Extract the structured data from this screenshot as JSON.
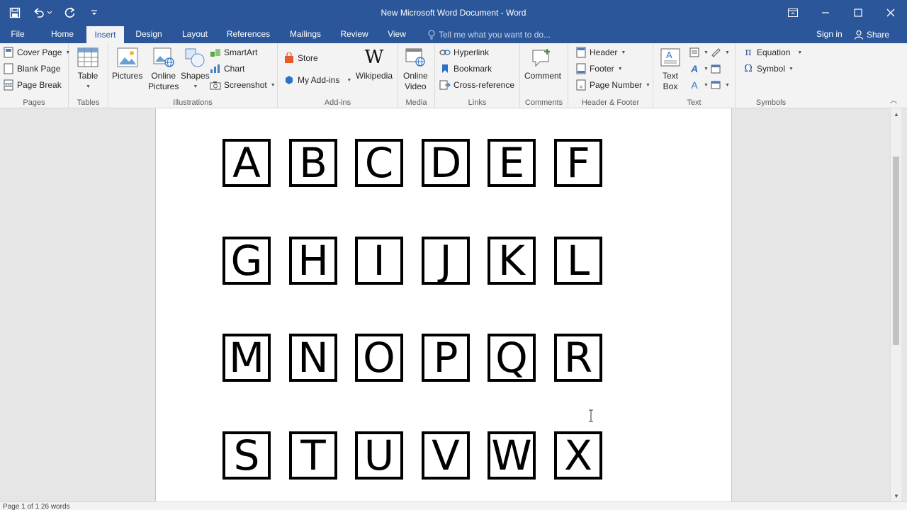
{
  "window": {
    "title": "New Microsoft Word Document - Word"
  },
  "quick_access": {
    "save_icon": "save-icon",
    "undo_icon": "undo-icon",
    "redo_icon": "redo-icon",
    "customize_icon": "customize-icon"
  },
  "tabs": [
    {
      "label": "File"
    },
    {
      "label": "Home"
    },
    {
      "label": "Insert"
    },
    {
      "label": "Design"
    },
    {
      "label": "Layout"
    },
    {
      "label": "References"
    },
    {
      "label": "Mailings"
    },
    {
      "label": "Review"
    },
    {
      "label": "View"
    }
  ],
  "active_tab": "Insert",
  "tellme": {
    "placeholder": "Tell me what you want to do..."
  },
  "account": {
    "signin": "Sign in",
    "share": "Share"
  },
  "ribbon": {
    "pages": {
      "label": "Pages",
      "cover": "Cover Page",
      "blank": "Blank Page",
      "break": "Page Break"
    },
    "tables": {
      "label": "Tables",
      "table": "Table"
    },
    "illustrations": {
      "label": "Illustrations",
      "pictures": "Pictures",
      "online_pictures_1": "Online",
      "online_pictures_2": "Pictures",
      "shapes": "Shapes",
      "smartart": "SmartArt",
      "chart": "Chart",
      "screenshot": "Screenshot"
    },
    "addins": {
      "label": "Add-ins",
      "store": "Store",
      "myaddins": "My Add-ins",
      "wikipedia": "Wikipedia"
    },
    "media": {
      "label": "Media",
      "online_video_1": "Online",
      "online_video_2": "Video"
    },
    "links": {
      "label": "Links",
      "hyperlink": "Hyperlink",
      "bookmark": "Bookmark",
      "crossref": "Cross-reference"
    },
    "comments": {
      "label": "Comments",
      "comment": "Comment"
    },
    "header_footer": {
      "label": "Header & Footer",
      "header": "Header",
      "footer": "Footer",
      "page_number": "Page Number"
    },
    "text": {
      "label": "Text",
      "textbox_1": "Text",
      "textbox_2": "Box"
    },
    "symbols": {
      "label": "Symbols",
      "equation": "Equation",
      "symbol": "Symbol"
    }
  },
  "document": {
    "letters": [
      "A",
      "B",
      "C",
      "D",
      "E",
      "F",
      "G",
      "H",
      "I",
      "J",
      "K",
      "L",
      "M",
      "N",
      "O",
      "P",
      "Q",
      "R",
      "S",
      "T",
      "U",
      "V",
      "W",
      "X"
    ]
  },
  "statusbar": {
    "text": "Page 1 of 1    26 words"
  },
  "colors": {
    "brand": "#2b579a",
    "ribbon_bg": "#f3f3f3",
    "doc_bg": "#e6e6e6"
  }
}
